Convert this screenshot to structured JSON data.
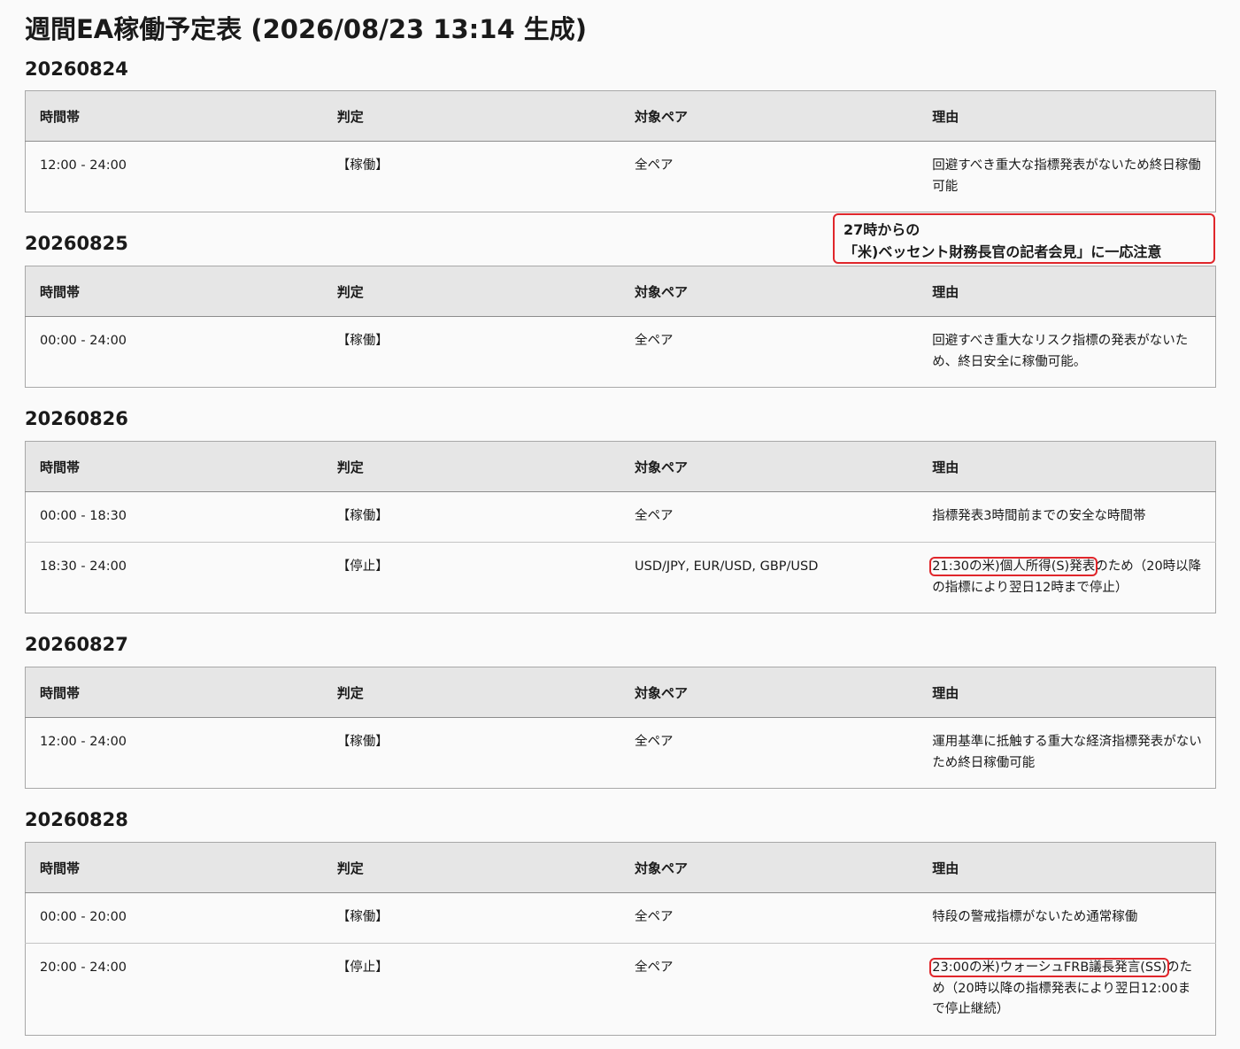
{
  "page": {
    "title": "週間EA稼働予定表 (2026/08/23 13:14 生成)"
  },
  "headers": [
    "時間帯",
    "判定",
    "対象ペア",
    "理由"
  ],
  "days": [
    {
      "date": "20260824",
      "rows": [
        {
          "time": "12:00 - 24:00",
          "status": "【稼働】",
          "pairs": "全ペア",
          "reason_hl": "",
          "reason": "回避すべき重大な指標発表がないため終日稼働可能"
        }
      ]
    },
    {
      "date": "20260825",
      "rows": [
        {
          "time": "00:00 - 24:00",
          "status": "【稼働】",
          "pairs": "全ペア",
          "reason_hl": "",
          "reason": "回避すべき重大なリスク指標の発表がないため、終日安全に稼働可能。"
        }
      ]
    },
    {
      "date": "20260826",
      "rows": [
        {
          "time": "00:00 - 18:30",
          "status": "【稼働】",
          "pairs": "全ペア",
          "reason_hl": "",
          "reason": "指標発表3時間前までの安全な時間帯"
        },
        {
          "time": "18:30 - 24:00",
          "status": "【停止】",
          "pairs": "USD/JPY, EUR/USD, GBP/USD",
          "reason_hl": "21:30の米)個人所得(S)発表",
          "reason": "のため（20時以降の指標により翌日12時まで停止）"
        }
      ]
    },
    {
      "date": "20260827",
      "rows": [
        {
          "time": "12:00 - 24:00",
          "status": "【稼働】",
          "pairs": "全ペア",
          "reason_hl": "",
          "reason": "運用基準に抵触する重大な経済指標発表がないため終日稼働可能"
        }
      ]
    },
    {
      "date": "20260828",
      "rows": [
        {
          "time": "00:00 - 20:00",
          "status": "【稼働】",
          "pairs": "全ペア",
          "reason_hl": "",
          "reason": "特段の警戒指標がないため通常稼働"
        },
        {
          "time": "20:00 - 24:00",
          "status": "【停止】",
          "pairs": "全ペア",
          "reason_hl": "23:00の米)ウォーシュFRB議長発言(SS)",
          "reason": "のため（20時以降の指標発表により翌日12:00まで停止継続）"
        }
      ]
    }
  ],
  "callout": {
    "line1": "27時からの",
    "line2": "「米)ベッセント財務長官の記者会見」に一応注意"
  },
  "colors": {
    "annotation_red": "#e0262b",
    "header_bg": "#e6e6e6",
    "page_bg": "#fafafa"
  }
}
